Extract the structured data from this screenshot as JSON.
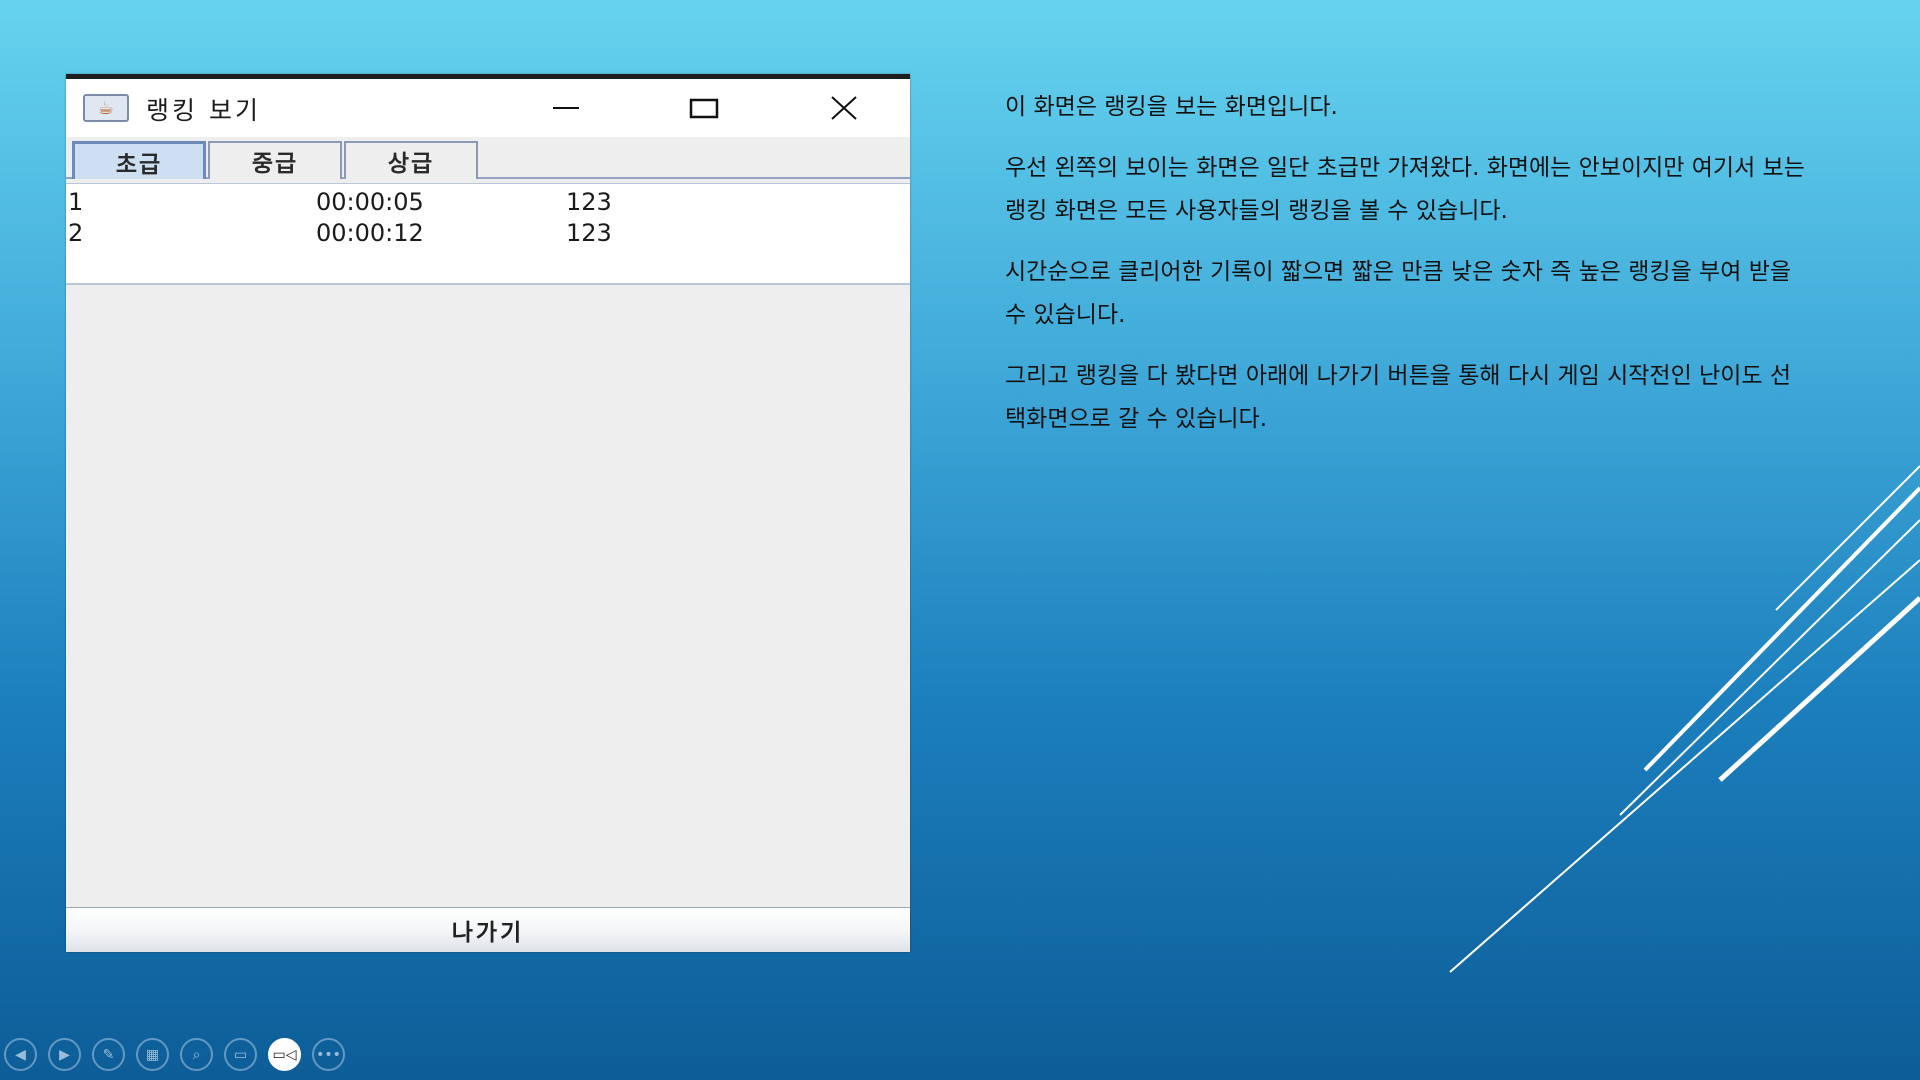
{
  "window": {
    "title": "랭킹 보기",
    "tabs": [
      {
        "label": "초급",
        "selected": true
      },
      {
        "label": "중급",
        "selected": false
      },
      {
        "label": "상급",
        "selected": false
      }
    ],
    "rankings": [
      {
        "rank": "1",
        "time": "00:00:05",
        "score": "123"
      },
      {
        "rank": "2",
        "time": "00:00:12",
        "score": "123"
      }
    ],
    "exit_button": "나가기",
    "controls": {
      "minimize_icon": "minimize-icon",
      "maximize_icon": "maximize-icon",
      "close_icon": "close-icon"
    }
  },
  "description": {
    "paragraphs": [
      "이 화면은 랭킹을 보는 화면입니다.",
      "우선 왼쪽의 보이는 화면은 일단 초급만 가져왔다. 화면에는 안보이지만 여기서 보는 랭킹 화면은 모든 사용자들의 랭킹을 볼 수 있습니다.",
      "시간순으로 클리어한 기록이 짧으면 짧은 만큼 낮은 숫자 즉 높은 랭킹을 부여 받을 수 있습니다.",
      "그리고 랭킹을 다 봤다면 아래에 나가기 버튼을 통해 다시 게임 시작전인 난이도 선택화면으로 갈 수 있습니다."
    ]
  },
  "slideshow_controls": [
    {
      "icon": "previous-icon"
    },
    {
      "icon": "next-icon"
    },
    {
      "icon": "pen-icon"
    },
    {
      "icon": "slides-grid-icon"
    },
    {
      "icon": "zoom-icon"
    },
    {
      "icon": "subtitles-icon"
    },
    {
      "icon": "camera-icon",
      "active": true
    },
    {
      "icon": "more-options-icon"
    }
  ],
  "colors": {
    "background_top": "#66d3ef",
    "background_bottom": "#0d5d97",
    "tab_selected": "#cfdff2"
  }
}
